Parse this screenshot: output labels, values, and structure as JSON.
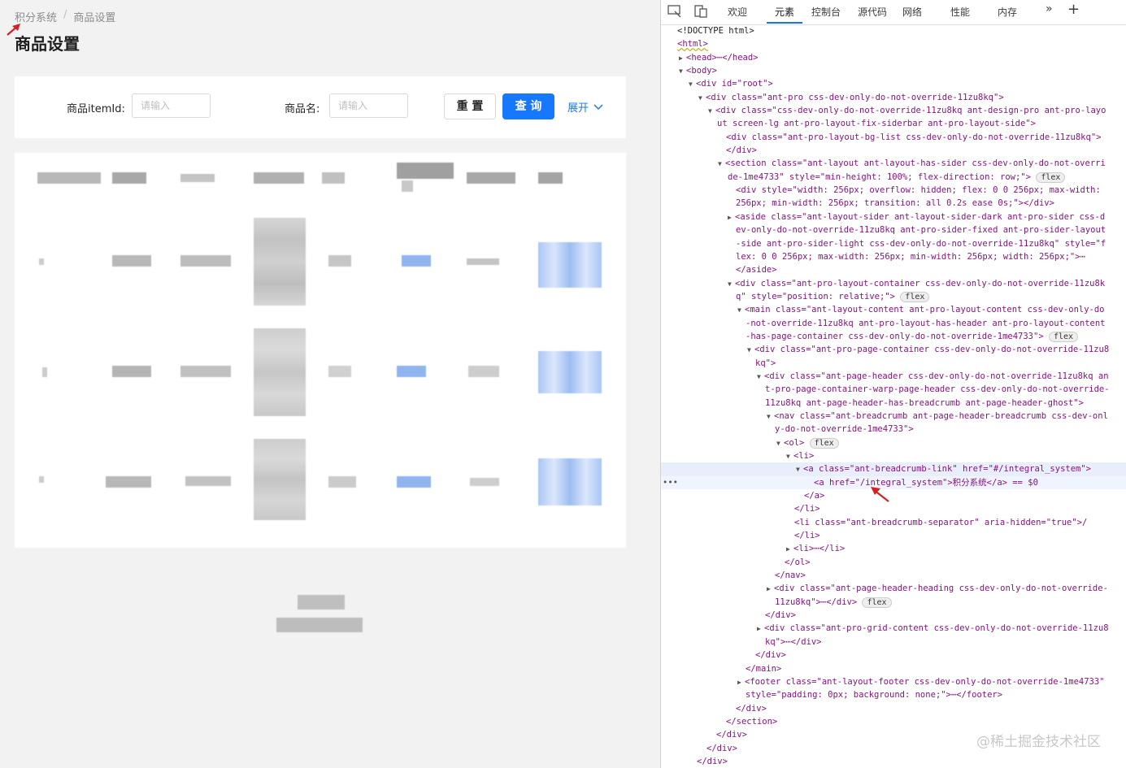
{
  "breadcrumb": {
    "items": [
      "积分系统",
      "商品设置"
    ],
    "separator": "/"
  },
  "page_title": "商品设置",
  "search_form": {
    "item_id_label": "商品itemId:",
    "item_id_placeholder": "请输入",
    "name_label": "商品名:",
    "name_placeholder": "请输入",
    "reset_label": "重 置",
    "query_label": "查 询",
    "expand_label": "展开"
  },
  "devtools": {
    "tabs": [
      "欢迎",
      "元素",
      "控制台",
      "源代码",
      "网络",
      "性能",
      "内存"
    ],
    "active_tab": "元素",
    "lines": [
      "<!DOCTYPE html>",
      "<html>",
      "<head>⋯</head>",
      "<body>",
      "<div id=\"root\">",
      "<div class=\"ant-pro css-dev-only-do-not-override-11zu8kq\">",
      "<div class=\"css-dev-only-do-not-override-11zu8kq ant-design-pro ant-pro-layo",
      "ut screen-lg ant-pro-layout-fix-siderbar ant-pro-layout-side\">",
      "<div class=\"ant-pro-layout-bg-list css-dev-only-do-not-override-11zu8kq\">",
      "</div>",
      "<section class=\"ant-layout ant-layout-has-sider css-dev-only-do-not-overri",
      "de-1me4733\" style=\"min-height: 100%; flex-direction: row;\">",
      "<div style=\"width: 256px; overflow: hidden; flex: 0 0 256px; max-width:",
      "256px; min-width: 256px; transition: all 0.2s ease 0s;\"></div>",
      "<aside class=\"ant-layout-sider ant-layout-sider-dark ant-pro-sider css-d",
      "ev-only-do-not-override-11zu8kq ant-pro-sider-fixed ant-pro-sider-layout",
      "-side ant-pro-sider-light css-dev-only-do-not-override-11zu8kq\" style=\"f",
      "lex: 0 0 256px; max-width: 256px; min-width: 256px; width: 256px;\">⋯",
      "</aside>",
      "<div class=\"ant-pro-layout-container css-dev-only-do-not-override-11zu8k",
      "q\" style=\"position: relative;\">",
      "<main class=\"ant-layout-content ant-pro-layout-content css-dev-only-do",
      "-not-override-11zu8kq ant-pro-layout-has-header ant-pro-layout-content",
      "-has-page-container css-dev-only-do-not-override-1me4733\">",
      "<div class=\"ant-pro-page-container css-dev-only-do-not-override-11zu8",
      "kq\">",
      "<div class=\"ant-page-header css-dev-only-do-not-override-11zu8kq an",
      "t-pro-page-container-warp-page-header css-dev-only-do-not-override-",
      "11zu8kq ant-page-header-has-breadcrumb ant-page-header-ghost\">",
      "<nav class=\"ant-breadcrumb ant-page-header-breadcrumb css-dev-onl",
      "y-do-not-override-1me4733\">",
      "<ol>",
      "<li>",
      "<a class=\"ant-breadcrumb-link\" href=\"#/integral_system\">",
      "<a href=\"/integral_system\">积分系统</a> == $0",
      "</a>",
      "</li>",
      "<li class=\"ant-breadcrumb-separator\" aria-hidden=\"true\">/",
      "</li>",
      "<li>⋯</li>",
      "</ol>",
      "</nav>",
      "<div class=\"ant-page-header-heading css-dev-only-do-not-override-",
      "11zu8kq\">⋯</div>",
      "</div>",
      "<div class=\"ant-pro-grid-content css-dev-only-do-not-override-11zu8",
      "kq\">⋯</div>",
      "</div>",
      "</main>",
      "<footer class=\"ant-layout-footer css-dev-only-do-not-override-1me4733\"",
      "style=\"padding: 0px; background: none;\">⋯</footer>",
      "</div>",
      "</section>",
      "</div>",
      "</div>",
      "</div>"
    ],
    "flex_badge": "flex",
    "selected_marker": "•••"
  },
  "watermark": "@稀土掘金技术社区",
  "colors": {
    "primary": "#1677ff",
    "tag": "#881280",
    "attr_name": "#994500",
    "attr_value": "#1a1aa6"
  }
}
